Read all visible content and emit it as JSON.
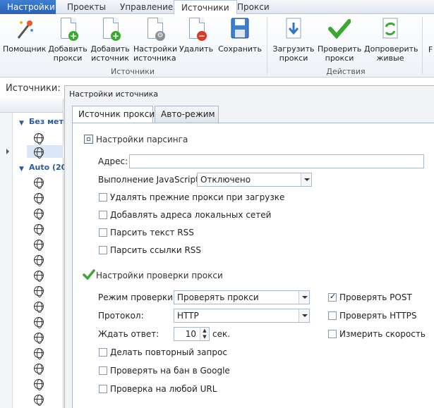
{
  "menu": {
    "tabs": [
      "Настройки",
      "Проекты",
      "Управление",
      "Источники",
      "Прокси"
    ],
    "active": "Источники"
  },
  "ribbon": {
    "buttons": [
      {
        "label1": "Помощник",
        "label2": "",
        "icon": "magic-wand-icon"
      },
      {
        "label1": "Добавить",
        "label2": "прокси",
        "icon": "add-proxy-icon"
      },
      {
        "label1": "Добавить",
        "label2": "источник",
        "icon": "add-source-icon"
      },
      {
        "label1": "Настройки",
        "label2": "источника",
        "icon": "source-settings-icon"
      },
      {
        "label1": "Удалить",
        "label2": "",
        "icon": "delete-icon"
      },
      {
        "label1": "Сохранить",
        "label2": "",
        "icon": "save-icon"
      },
      {
        "label1": "Загрузить",
        "label2": "прокси",
        "icon": "download-proxy-icon"
      },
      {
        "label1": "Проверить",
        "label2": "прокси",
        "icon": "check-proxy-icon"
      },
      {
        "label1": "Допроверить",
        "label2": "живые",
        "icon": "recheck-alive-icon"
      }
    ],
    "groups": {
      "sources": "Источники",
      "actions": "Действия"
    },
    "overflow": "F"
  },
  "left": {
    "title": "Источники:",
    "groups": [
      "Без метк",
      "Auto (20"
    ]
  },
  "dialog": {
    "title": "Настройки источника",
    "tabs": [
      "Источник прокси",
      "Авто-режим"
    ],
    "parsing": {
      "section": "Настройки парсинга",
      "address_label": "Адрес:",
      "address_value": "",
      "js_label": "Выполнение JavaScript:",
      "js_value": "Отключено",
      "options": [
        {
          "label": "Удалять прежние прокси при загрузке",
          "checked": false
        },
        {
          "label": "Добавлять адреса локальных сетей",
          "checked": false
        },
        {
          "label": "Парсить текст RSS",
          "checked": false
        },
        {
          "label": "Парсить ссылки RSS",
          "checked": false
        }
      ]
    },
    "checking": {
      "section": "Настройки проверки прокси",
      "mode_label": "Режим проверки:",
      "mode_value": "Проверять прокси",
      "protocol_label": "Протокол:",
      "protocol_value": "HTTP",
      "wait_label": "Ждать ответ:",
      "wait_value": "10",
      "wait_unit": "сек.",
      "right_options": [
        {
          "label": "Проверять POST",
          "checked": true
        },
        {
          "label": "Проверять HTTPS",
          "checked": false
        },
        {
          "label": "Измерить скорость",
          "checked": false
        }
      ],
      "options": [
        {
          "label": "Делать повторный запрос",
          "checked": false
        },
        {
          "label": "Проверять на бан в Google",
          "checked": false
        },
        {
          "label": "Проверка на любой URL",
          "checked": false
        }
      ]
    }
  },
  "colors": {
    "accent": "#2a62b6",
    "check": "#3aa832",
    "delete": "#d93a2a"
  }
}
